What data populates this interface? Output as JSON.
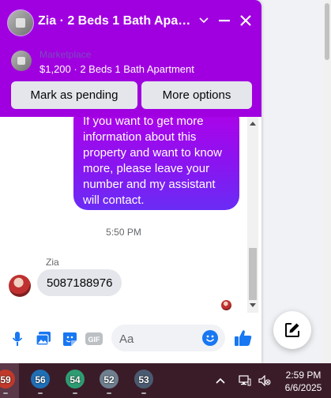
{
  "header": {
    "title": "Zia · 2 Beds 1 Bath Apartm...",
    "listing_source": "Marketplace",
    "listing_line": "$1,200 · 2 Beds 1 Bath Apartment",
    "mark_pending_label": "Mark as pending",
    "more_options_label": "More options"
  },
  "messages": {
    "outgoing_text": "If you want to get more information about this property and want to know more, please leave your number and my assistant will contact.",
    "time_separator": "5:50 PM",
    "sender_name": "Zia",
    "incoming_text": "5087188976"
  },
  "composer": {
    "gif_label": "GIF",
    "input_placeholder": "Aa",
    "input_value": ""
  },
  "taskbar": {
    "weather_badges": [
      {
        "temp": "59",
        "color": "#c0392b"
      },
      {
        "temp": "56",
        "color": "#1f6fb5"
      },
      {
        "temp": "54",
        "color": "#2e9c73"
      },
      {
        "temp": "52",
        "color": "#6e7f8f"
      },
      {
        "temp": "53",
        "color": "#4a5a70"
      }
    ],
    "clock_time": "2:59 PM",
    "clock_date": "6/6/2025"
  },
  "colors": {
    "header_bg": "#a000e0",
    "outgoing_bubble": "#8a14f0",
    "accent_blue": "#1877f2",
    "taskbar_bg": "#3a1c28"
  },
  "icons": [
    "chevron-down-icon",
    "minimize-icon",
    "close-icon",
    "microphone-icon",
    "photo-icon",
    "sticker-icon",
    "gif-icon",
    "emoji-icon",
    "thumbs-up-icon",
    "compose-icon",
    "chevron-up-icon",
    "network-icon",
    "volume-muted-icon"
  ]
}
